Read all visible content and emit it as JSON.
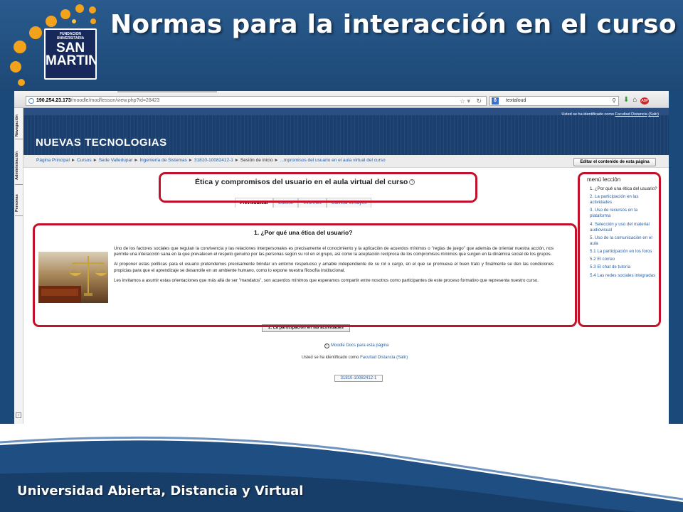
{
  "slide": {
    "title": "Normas para la interacción en el curso",
    "footer": "Universidad Abierta, Distancia y Virtual",
    "logo": {
      "line1": "FUNDACION",
      "line2": "UNIVERSITARIA",
      "line3": "SAN",
      "line4": "MARTIN"
    }
  },
  "browser": {
    "url_host": "190.254.23.173",
    "url_path": "/moodle/mod/lesson/view.php?id=28423",
    "search_value": "textaloud",
    "search_engine": "g-icon"
  },
  "moodle": {
    "dock": [
      "Navegación",
      "Administración",
      "Personas"
    ],
    "login_prefix": "Usted se ha identificado como",
    "login_user": "Facultad Distancia",
    "login_logout": "(Salir)",
    "course_name": "NUEVAS TECNOLOGIAS",
    "breadcrumb": [
      "Página Principal",
      "Cursos",
      "Sede Valledupar",
      "Ingeniería de Sistemas",
      "31810-10082412-1",
      "Sesión de inicio",
      "...mpromisos del usuario en el aula virtual del curso"
    ],
    "edit_button": "Editar el contenido de esta página",
    "lesson_title": "Ética y compromisos del usuario en el aula virtual del curso",
    "tabs": [
      "Previsualizar",
      "Edición",
      "Informes",
      "Calificar ensayos"
    ],
    "page_heading": "1. ¿Por qué una ética del usuario?",
    "paragraphs": [
      "Uno de los factores sociales que regulan la convivencia y las relaciones interpersonales es precisamente el conocimiento y la aplicación de acuerdos mínimos o \"reglas de juego\" que además de orientar nuestra acción, nos permite una interacción sana en la que prevalecen el respeto genuino por las personas según su rol en el grupo, así como la aceptación recíproca de los compromisos mínimos que surgen en la dinámica social de los grupos.",
      "Al proponer estas políticas para el usuario pretendemos precisamente brindar un entorno respetuoso y amable independiente de su rol o cargo, en el que se promueva el buen trato y finalmente se den las condiciones propicias para que el aprendizaje se desarrolle en un ambiente humano, como lo expone nuestra filosofía institucional.",
      "Les invitamos a asumir estas orientaciones que más allá de ser \"mandatos\", son acuerdos mínimos que esperamos compartir entre nosotros como participantes de este proceso formativo que representa nuestro curso."
    ],
    "next_button": "2. La participación en las actividades",
    "block_title": "menú lección",
    "menu": [
      "1. ¿Por qué una ética del usuario?",
      "2. La participación en las actividades",
      "3. Uso de recursos en la plataforma",
      "4. Selección y uso del material audiovisual",
      "5. Uso de la comunicación en el aula",
      "5.1 La participación en los foros",
      "5.2 El correo",
      "5.3 El chat de tutoría",
      "5.4 Las redes sociales integradas"
    ],
    "docs_link": "Moodle Docs para esta página",
    "footer_login_prefix": "Usted se ha identificado como",
    "footer_login_user": "Facultad Distancia",
    "footer_login_logout": "(Salir)",
    "footer_course": "31810-10082412-1"
  },
  "colors": {
    "accent_red": "#c2122b",
    "header_blue": "#21507f",
    "link_blue": "#2a5fa5"
  }
}
